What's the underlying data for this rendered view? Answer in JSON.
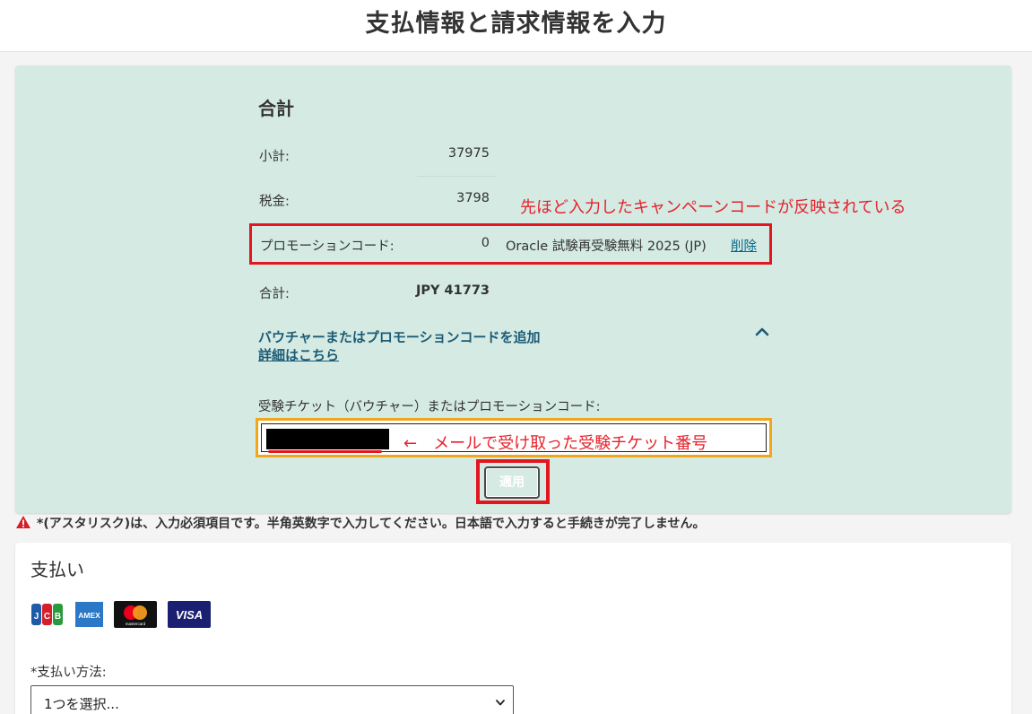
{
  "page": {
    "title": "支払情報と請求情報を入力"
  },
  "summary": {
    "heading": "合計",
    "subtotal_label": "小計:",
    "subtotal_value": "37975",
    "tax_label": "税金:",
    "tax_value": "3798",
    "promo_label": "プロモーションコード:",
    "promo_value": "0",
    "promo_name": "Oracle 試験再受験無料 2025 (JP)",
    "promo_remove": "削除",
    "total_label": "合計:",
    "total_value": "JPY 41773"
  },
  "annotations": {
    "promo_note": "先ほど入力したキャンペーンコードが反映されている",
    "code_note": "←　メールで受け取った受験チケット番号"
  },
  "voucher": {
    "toggle_label": "バウチャーまたはプロモーションコードを追加",
    "details_link": "詳細はこちら",
    "field_label": "受験チケット（バウチャー）またはプロモーションコード:",
    "apply_button": "適用"
  },
  "notice": "*(アスタリスク)は、入力必須項目です。半角英数字で入力してください。日本語で入力すると手続きが完了しません。",
  "payment": {
    "heading": "支払い",
    "cards": [
      {
        "name": "JCB",
        "icon": "jcb-card-icon"
      },
      {
        "name": "AMEX",
        "icon": "amex-card-icon"
      },
      {
        "name": "mastercard",
        "icon": "mastercard-icon"
      },
      {
        "name": "VISA",
        "icon": "visa-card-icon"
      }
    ],
    "method_label": "*支払い方法:",
    "method_selected": "1つを選択..."
  },
  "colors": {
    "summary_bg": "#d4eae3",
    "annotation_red": "#e6212b",
    "link_blue": "#00688c",
    "input_highlight": "#f0a81a"
  }
}
